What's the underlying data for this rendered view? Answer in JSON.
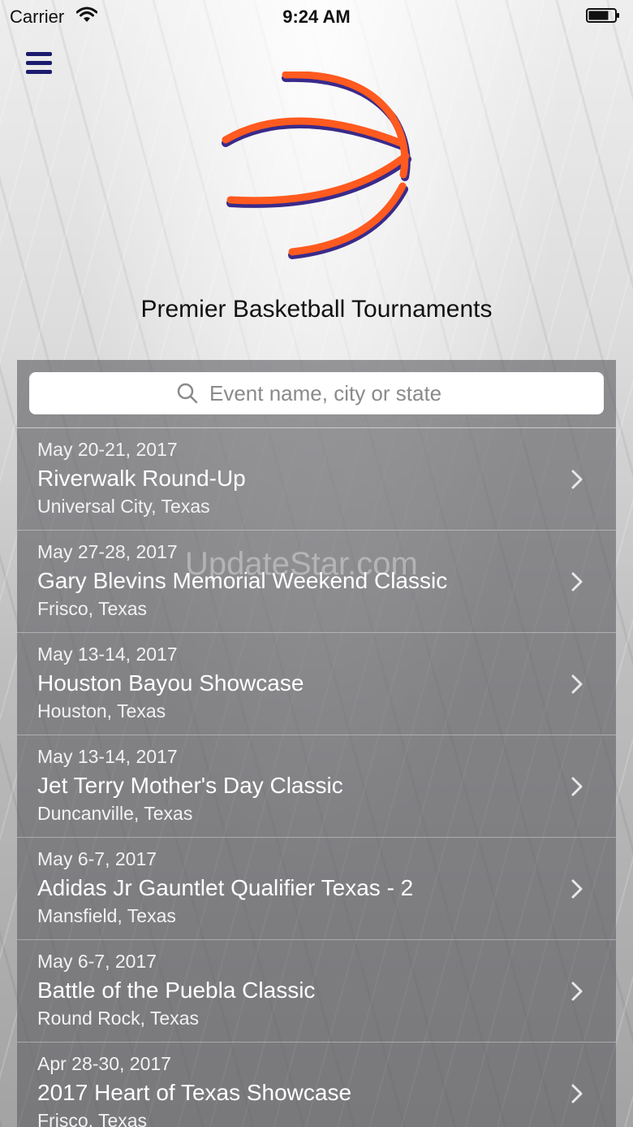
{
  "status_bar": {
    "carrier": "Carrier",
    "time": "9:24 AM"
  },
  "header": {
    "menu_icon": "hamburger-menu-icon",
    "logo_icon": "basketball-logo-icon",
    "title": "Premier Basketball Tournaments"
  },
  "search": {
    "placeholder": "Event name, city or state",
    "value": ""
  },
  "events": [
    {
      "date": "May 20-21, 2017",
      "name": "Riverwalk Round-Up",
      "location": "Universal City, Texas"
    },
    {
      "date": "May 27-28, 2017",
      "name": "Gary Blevins Memorial Weekend Classic",
      "location": "Frisco, Texas"
    },
    {
      "date": "May 13-14, 2017",
      "name": "Houston Bayou Showcase",
      "location": "Houston, Texas"
    },
    {
      "date": "May 13-14, 2017",
      "name": "Jet Terry Mother's Day Classic",
      "location": "Duncanville, Texas"
    },
    {
      "date": "May 6-7, 2017",
      "name": "Adidas Jr Gauntlet Qualifier Texas - 2",
      "location": "Mansfield, Texas"
    },
    {
      "date": "May 6-7, 2017",
      "name": "Battle of the Puebla Classic",
      "location": "Round Rock, Texas"
    },
    {
      "date": "Apr 28-30, 2017",
      "name": "2017 Heart of Texas Showcase",
      "location": "Frisco, Texas"
    }
  ],
  "watermark": "UpdateStar.com",
  "colors": {
    "logo_orange": "#ff5a1f",
    "logo_shadow": "#3a2a8a",
    "menu_navy": "#1c1c6e"
  }
}
